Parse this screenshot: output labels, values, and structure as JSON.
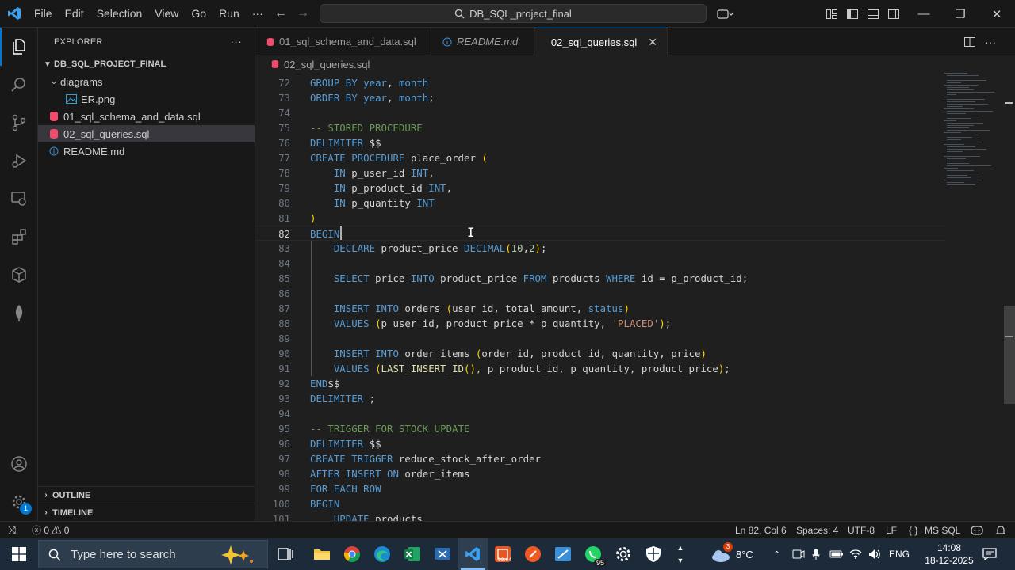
{
  "titlebar": {
    "menu": [
      "File",
      "Edit",
      "Selection",
      "View",
      "Go",
      "Run"
    ],
    "more": "···",
    "search_text": "DB_SQL_project_final"
  },
  "sidebar": {
    "title": "EXPLORER",
    "more": "···",
    "root": "DB_SQL_PROJECT_FINAL",
    "items": [
      {
        "label": "diagrams",
        "type": "folder"
      },
      {
        "label": "ER.png",
        "type": "image"
      },
      {
        "label": "01_sql_schema_and_data.sql",
        "type": "sql"
      },
      {
        "label": "02_sql_queries.sql",
        "type": "sql"
      },
      {
        "label": "README.md",
        "type": "md"
      }
    ],
    "outline": "OUTLINE",
    "timeline": "TIMELINE",
    "accounts_badge": "1"
  },
  "tabs": [
    {
      "label": "01_sql_schema_and_data.sql"
    },
    {
      "label": "README.md"
    },
    {
      "label": "02_sql_queries.sql"
    }
  ],
  "breadcrumb": "02_sql_queries.sql",
  "editor": {
    "lines": [
      {
        "n": "72",
        "c": "GROUP BY year, month"
      },
      {
        "n": "73",
        "c": "ORDER BY year, month;"
      },
      {
        "n": "74",
        "c": ""
      },
      {
        "n": "75",
        "c": "-- STORED PROCEDURE"
      },
      {
        "n": "76",
        "c": "DELIMITER $$"
      },
      {
        "n": "77",
        "c": "CREATE PROCEDURE place_order ("
      },
      {
        "n": "78",
        "c": "    IN p_user_id INT,"
      },
      {
        "n": "79",
        "c": "    IN p_product_id INT,"
      },
      {
        "n": "80",
        "c": "    IN p_quantity INT"
      },
      {
        "n": "81",
        "c": ")"
      },
      {
        "n": "82",
        "c": "BEGIN"
      },
      {
        "n": "83",
        "c": "    DECLARE product_price DECIMAL(10,2);"
      },
      {
        "n": "84",
        "c": ""
      },
      {
        "n": "85",
        "c": "    SELECT price INTO product_price FROM products WHERE id = p_product_id;"
      },
      {
        "n": "86",
        "c": ""
      },
      {
        "n": "87",
        "c": "    INSERT INTO orders (user_id, total_amount, status)"
      },
      {
        "n": "88",
        "c": "    VALUES (p_user_id, product_price * p_quantity, 'PLACED');"
      },
      {
        "n": "89",
        "c": ""
      },
      {
        "n": "90",
        "c": "    INSERT INTO order_items (order_id, product_id, quantity, price)"
      },
      {
        "n": "91",
        "c": "    VALUES (LAST_INSERT_ID(), p_product_id, p_quantity, product_price);"
      },
      {
        "n": "92",
        "c": "END$$"
      },
      {
        "n": "93",
        "c": "DELIMITER ;"
      },
      {
        "n": "94",
        "c": ""
      },
      {
        "n": "95",
        "c": "-- TRIGGER FOR STOCK UPDATE"
      },
      {
        "n": "96",
        "c": "DELIMITER $$"
      },
      {
        "n": "97",
        "c": "CREATE TRIGGER reduce_stock_after_order"
      },
      {
        "n": "98",
        "c": "AFTER INSERT ON order_items"
      },
      {
        "n": "99",
        "c": "FOR EACH ROW"
      },
      {
        "n": "100",
        "c": "BEGIN"
      },
      {
        "n": "101",
        "c": "    UPDATE products"
      }
    ],
    "current_line": "82"
  },
  "statusbar": {
    "errors": "0",
    "warnings": "0",
    "position": "Ln 82, Col 6",
    "spaces": "Spaces: 4",
    "encoding": "UTF-8",
    "eol": "LF",
    "language": "MS SQL"
  },
  "taskbar": {
    "search_placeholder": "Type here to search",
    "whatsapp_badge": "95",
    "weather_badge": "3",
    "temperature": "8°C",
    "language": "ENG",
    "time": "14:08",
    "date": "18-12-2025"
  },
  "colors": {
    "accent": "#0078d4",
    "keyword": "#569cd6",
    "comment": "#6a9955",
    "string": "#ce9178",
    "number": "#b5cea8"
  }
}
